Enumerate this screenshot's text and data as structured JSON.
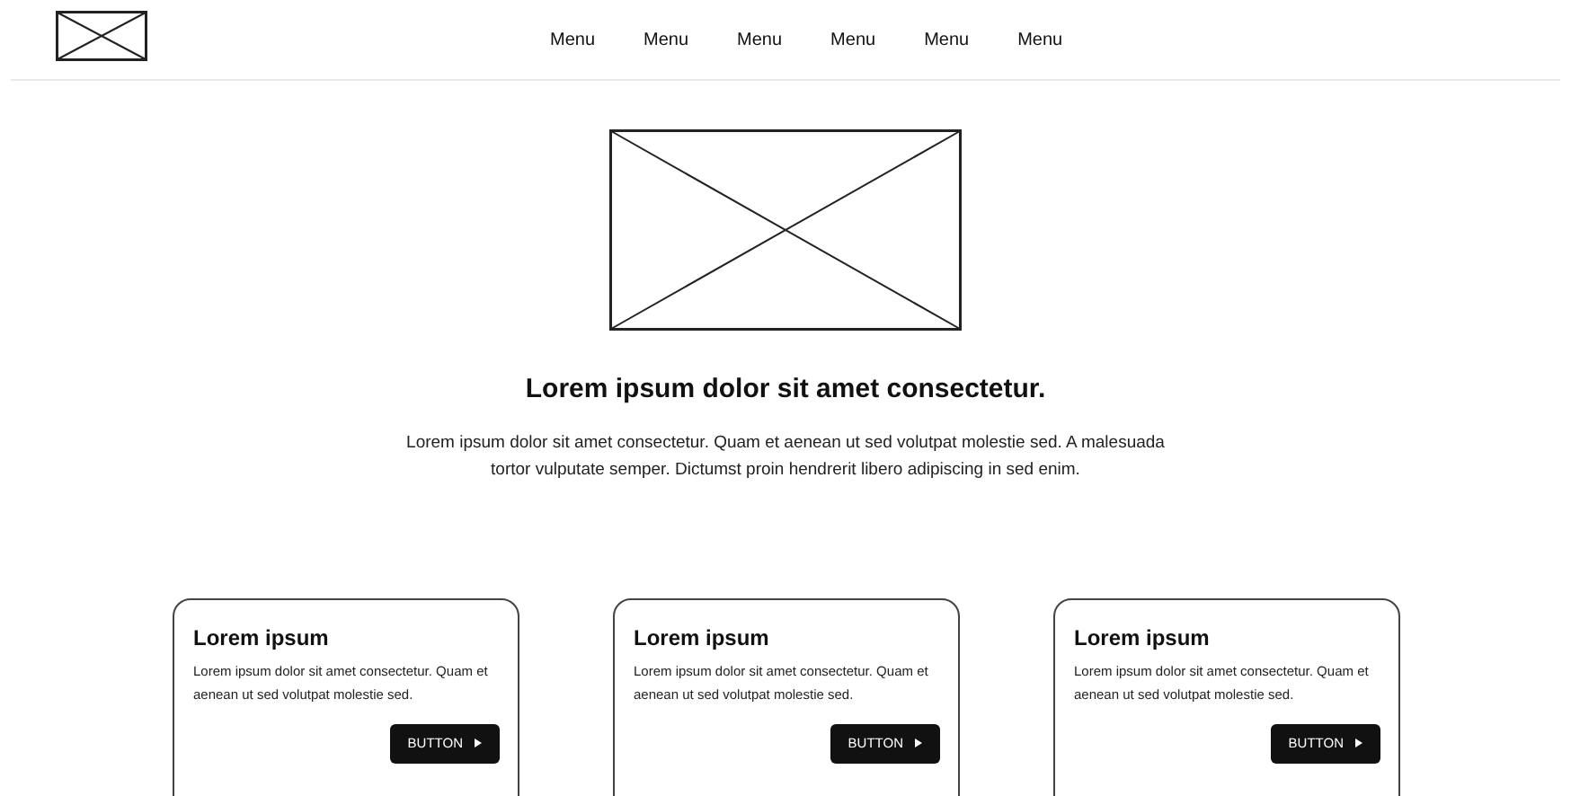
{
  "nav": {
    "menu": [
      "Menu",
      "Menu",
      "Menu",
      "Menu",
      "Menu",
      "Menu"
    ]
  },
  "hero": {
    "title": "Lorem ipsum dolor sit amet consectetur.",
    "text": "Lorem ipsum dolor sit amet consectetur. Quam et aenean ut sed volutpat molestie sed. A malesuada tortor vulputate semper. Dictumst proin hendrerit libero adipiscing in sed enim."
  },
  "cards": [
    {
      "title": "Lorem ipsum",
      "text": "Lorem ipsum dolor sit amet consectetur. Quam et aenean ut sed volutpat molestie sed.",
      "button": "BUTTON"
    },
    {
      "title": "Lorem ipsum",
      "text": "Lorem ipsum dolor sit amet consectetur. Quam et aenean ut sed volutpat molestie sed.",
      "button": "BUTTON"
    },
    {
      "title": "Lorem ipsum",
      "text": "Lorem ipsum dolor sit amet consectetur. Quam et aenean ut sed volutpat molestie sed.",
      "button": "BUTTON"
    }
  ]
}
